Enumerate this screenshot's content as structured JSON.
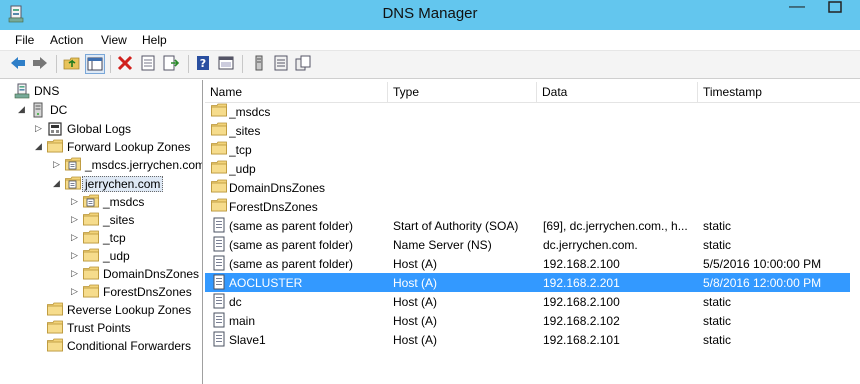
{
  "window": {
    "title": "DNS Manager",
    "minimize_glyph": "—",
    "close_glyph": ""
  },
  "menu": [
    "File",
    "Action",
    "View",
    "Help"
  ],
  "toolbar": {
    "buttons": [
      "back-icon",
      "forward-icon",
      "up-folder-icon",
      "show-hide-tree-icon",
      "delete-icon",
      "properties-icon",
      "export-list-icon",
      "help-icon",
      "console-icon",
      "server-icon",
      "list-view-icon",
      "copy-icon"
    ]
  },
  "tree": {
    "root": "DNS",
    "server": "DC",
    "global_logs": "Global Logs",
    "forward_zones": "Forward Lookup Zones",
    "zone_msdcs": "_msdcs.jerrychen.com",
    "zone_main": "jerrychen.com",
    "sub": [
      "_msdcs",
      "_sites",
      "_tcp",
      "_udp",
      "DomainDnsZones",
      "ForestDnsZones"
    ],
    "reverse_zones": "Reverse Lookup Zones",
    "trust_points": "Trust Points",
    "conditional_forwarders": "Conditional Forwarders"
  },
  "list": {
    "columns": [
      "Name",
      "Type",
      "Data",
      "Timestamp"
    ],
    "rows": [
      {
        "icon": "folder",
        "name": "_msdcs",
        "type": "",
        "data": "",
        "timestamp": ""
      },
      {
        "icon": "folder",
        "name": "_sites",
        "type": "",
        "data": "",
        "timestamp": ""
      },
      {
        "icon": "folder",
        "name": "_tcp",
        "type": "",
        "data": "",
        "timestamp": ""
      },
      {
        "icon": "folder",
        "name": "_udp",
        "type": "",
        "data": "",
        "timestamp": ""
      },
      {
        "icon": "folder",
        "name": "DomainDnsZones",
        "type": "",
        "data": "",
        "timestamp": ""
      },
      {
        "icon": "folder",
        "name": "ForestDnsZones",
        "type": "",
        "data": "",
        "timestamp": ""
      },
      {
        "icon": "record",
        "name": "(same as parent folder)",
        "type": "Start of Authority (SOA)",
        "data": "[69], dc.jerrychen.com., h...",
        "timestamp": "static"
      },
      {
        "icon": "record",
        "name": "(same as parent folder)",
        "type": "Name Server (NS)",
        "data": "dc.jerrychen.com.",
        "timestamp": "static"
      },
      {
        "icon": "record",
        "name": "(same as parent folder)",
        "type": "Host (A)",
        "data": "192.168.2.100",
        "timestamp": "5/5/2016 10:00:00 PM"
      },
      {
        "icon": "record",
        "name": "AOCLUSTER",
        "type": "Host (A)",
        "data": "192.168.2.201",
        "timestamp": "5/8/2016 12:00:00 PM"
      },
      {
        "icon": "record",
        "name": "dc",
        "type": "Host (A)",
        "data": "192.168.2.100",
        "timestamp": "static"
      },
      {
        "icon": "record",
        "name": "main",
        "type": "Host (A)",
        "data": "192.168.2.102",
        "timestamp": "static"
      },
      {
        "icon": "record",
        "name": "Slave1",
        "type": "Host (A)",
        "data": "192.168.2.101",
        "timestamp": "static"
      }
    ],
    "selected_row": "AOCLUSTER"
  },
  "colors": {
    "titlebar": "#63c6ee",
    "selection": "#3399ff",
    "folder": "#f2d37a"
  }
}
